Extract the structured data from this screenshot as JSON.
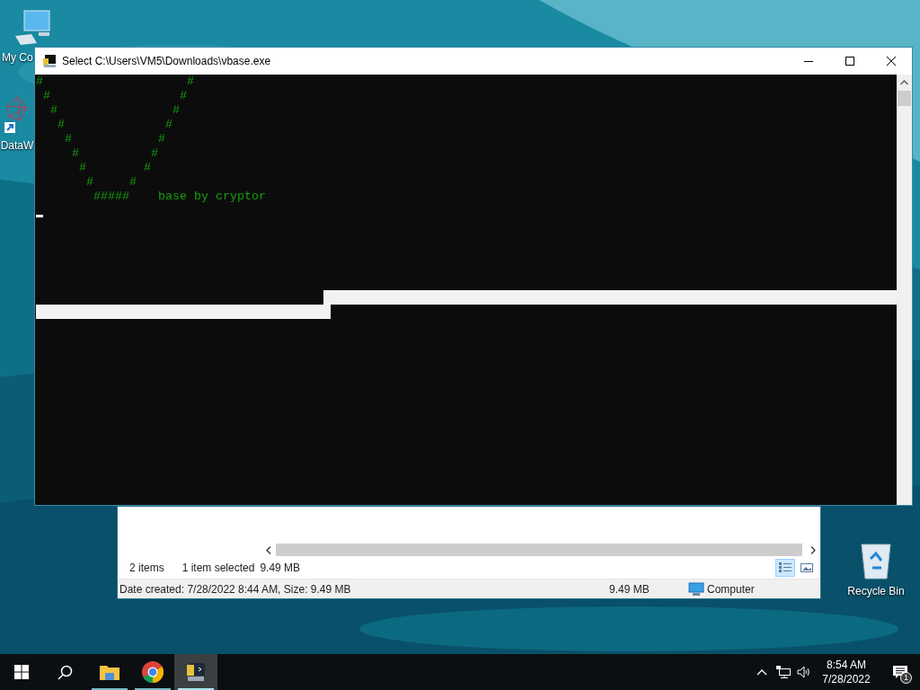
{
  "desktop_icons": [
    {
      "kind": "computer",
      "label": "My Co"
    },
    {
      "kind": "shortcut",
      "label": "DataW"
    },
    {
      "kind": "recycle-bin",
      "label": "Recycle Bin"
    }
  ],
  "explorer": {
    "item_count": "2 items",
    "selection": "1 item selected",
    "selection_size": "9.49 MB",
    "views": [
      {
        "kind": "details",
        "selected": true
      },
      {
        "kind": "large-icons",
        "selected": false
      }
    ],
    "details": "Date created: 7/28/2022 8:44 AM, Size: 9.49 MB",
    "size": "9.49 MB",
    "location": "Computer"
  },
  "console": {
    "title": "Select C:\\Users\\VM5\\Downloads\\vbase.exe",
    "lines": [
      "#                    #",
      " #                  #",
      "  #                #",
      "   #              #",
      "    #            #",
      "     #          #",
      "      #        #",
      "       #     #",
      "        #####    base by cryptor"
    ]
  },
  "taskbar": {
    "apps": [
      {
        "kind": "start",
        "running": false,
        "selected": false
      },
      {
        "kind": "search",
        "running": false,
        "selected": false
      },
      {
        "kind": "explorer",
        "running": true,
        "selected": false
      },
      {
        "kind": "chrome",
        "running": true,
        "selected": false
      },
      {
        "kind": "console",
        "running": true,
        "selected": true
      }
    ],
    "time": "8:54 AM",
    "date": "7/28/2022",
    "notifications": "1"
  }
}
